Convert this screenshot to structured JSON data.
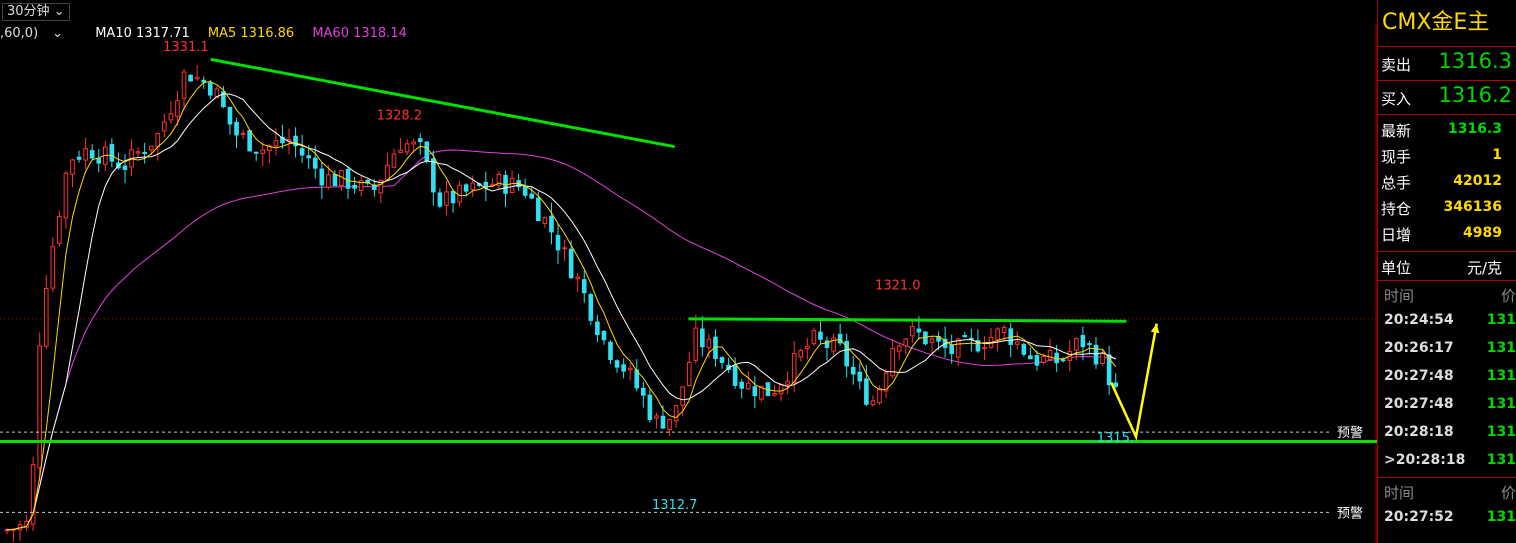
{
  "toolbar": {
    "period": "30分钟",
    "period_arrow": "⌄"
  },
  "ma_legend": [
    {
      "label": ",60,0)",
      "color": "#ffffff",
      "arrow": "⌄"
    },
    {
      "label": "MA10 1317.71",
      "color": "#ffffff"
    },
    {
      "label": "MA5 1316.86",
      "color": "#ffd800"
    },
    {
      "label": "MA60 1318.14",
      "color": "#e040e0"
    }
  ],
  "chart_data": {
    "type": "candlestick",
    "y_range": [
      1310.5,
      1332.5
    ],
    "colors": {
      "up": "#ff3030",
      "down": "#30e0f0",
      "ma5": "#ffd800",
      "ma10": "#ffffff",
      "ma60": "#e040e0",
      "trend": "#00e000",
      "arrow": "#ffff00"
    },
    "annotations": [
      {
        "label": "1331.1",
        "x": 0.135,
        "price": 1331.1,
        "color": "#ff3030",
        "kind": "high"
      },
      {
        "label": "1328.2",
        "x": 0.29,
        "price": 1328.2,
        "color": "#ff3030",
        "kind": "high"
      },
      {
        "label": "1321.0",
        "x": 0.652,
        "price": 1321.0,
        "color": "#ff3030",
        "kind": "high"
      },
      {
        "label": "1312.7",
        "x": 0.49,
        "price": 1312.7,
        "color": "#30e0f0",
        "kind": "low"
      },
      {
        "label": "1315.",
        "x": 0.81,
        "price": 1315.0,
        "color": "#30e0f0",
        "kind": "last"
      }
    ],
    "alerts": [
      {
        "label": "预警",
        "price": 1315.2
      },
      {
        "label": "预警",
        "price": 1311.8
      }
    ],
    "horizontal_line": {
      "price": 1314.8,
      "color": "#00e000"
    },
    "dotted_ref_price": 1320.0,
    "trendlines": [
      {
        "from": [
          0.153,
          1331.0
        ],
        "to": [
          0.49,
          1327.3
        ]
      },
      {
        "from": [
          0.5,
          1320.0
        ],
        "to": [
          0.818,
          1319.9
        ]
      }
    ],
    "arrows": [
      {
        "points": [
          [
            0.807,
            1317.3
          ],
          [
            0.825,
            1315.0
          ],
          [
            0.84,
            1319.8
          ]
        ]
      }
    ]
  },
  "panel": {
    "title": "CMX金E主",
    "sell_label": "卖出",
    "sell_value": "1316.3",
    "buy_label": "买入",
    "buy_value": "1316.2",
    "stats": [
      {
        "label": "最新",
        "value": "1316.3",
        "color": "#00d800"
      },
      {
        "label": "现手",
        "value": "1",
        "color": "#ffd800"
      },
      {
        "label": "总手",
        "value": "42012",
        "color": "#ffd800"
      },
      {
        "label": "持仓",
        "value": "346136",
        "color": "#ffd800"
      },
      {
        "label": "日增",
        "value": "4989",
        "color": "#ffd800"
      }
    ],
    "unit_label": "单位",
    "unit_value": "元/克",
    "ticks_header": "时间",
    "ticks_header2": "价",
    "ticks": [
      {
        "time": "20:24:54",
        "price": "131"
      },
      {
        "time": "20:26:17",
        "price": "131"
      },
      {
        "time": "20:27:48",
        "price": "131"
      },
      {
        "time": "20:27:48",
        "price": "131"
      },
      {
        "time": "20:28:18",
        "price": "131"
      },
      {
        "time": ">20:28:18",
        "price": "131"
      }
    ],
    "ticks2_header": "时间",
    "ticks2_header2": "价",
    "ticks2": [
      {
        "time": "20:27:52",
        "price": "131"
      }
    ]
  }
}
